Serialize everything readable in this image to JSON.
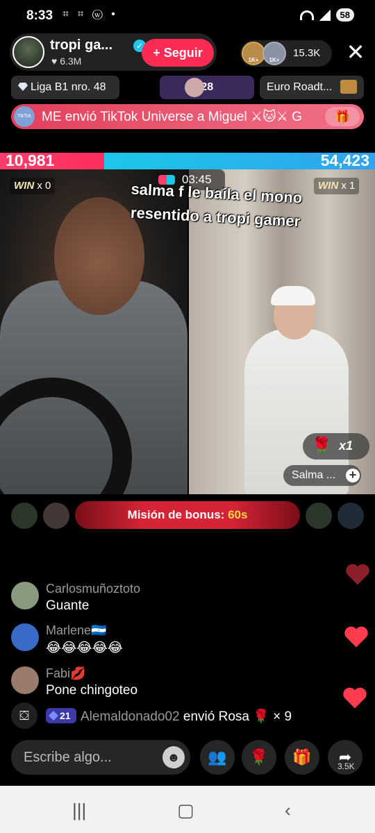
{
  "status_bar": {
    "time": "8:33",
    "notif_icons": "⌗ ⌗ ⓦ •",
    "battery": "58"
  },
  "header": {
    "host_name": "tropi ga...",
    "host_likes": "♥ 6.3M",
    "follow_label": "+ Seguir",
    "viewer_badge_1": "1K+",
    "viewer_badge_2": "1K+",
    "viewer_count": "15.3K",
    "close_symbol": "✕"
  },
  "tags": {
    "league": "Liga B1 nro. 48",
    "plus": "+28",
    "roadtrip": "Euro Roadt..."
  },
  "banner": {
    "logo_text": "TikTok LIVE",
    "text": "ME envió TikTok Universe a Miguel ⚔🐱⚔ G",
    "gift_symbol": "🎁"
  },
  "battle": {
    "score_left": "10,981",
    "score_right": "54,423",
    "win_left_label": "WIN",
    "win_left_count": "x 0",
    "win_right_label": "WIN",
    "win_right_count": "x 1",
    "timer": "03:45",
    "caption": "salma f le baila el mono resentido a tropi gamer",
    "gift_count": "x1",
    "guest_name": "Salma ...",
    "guest_plus": "+"
  },
  "mission": {
    "label": "Misión de bonus:",
    "seconds": "60s"
  },
  "chat": [
    {
      "user": "Carlosmuñoztoto",
      "message": "Guante"
    },
    {
      "user": "Marlene🇳🇮",
      "message": "😂😂😂😂😂"
    },
    {
      "user": "Fabi💋",
      "message": "Pone chingoteo"
    }
  ],
  "gift_event": {
    "badge": "21",
    "user": "Alemaldonado02",
    "text": "envió Rosa 🌹 × 9"
  },
  "bottom_bar": {
    "input_placeholder": "Escribe algo...",
    "emoji_symbol": "☻",
    "share_count": "3.5K"
  },
  "colors": {
    "red_team": "#ff3d6a",
    "blue_team": "#1cc7e8",
    "follow": "#fe2c55",
    "mission_seconds": "#ffd54a"
  },
  "icons": [
    "wifi-icon",
    "signal-icon",
    "verified-icon",
    "close-icon",
    "diamond-icon",
    "gift-icon",
    "heart-icon",
    "emoji-icon",
    "multi-guest-icon",
    "rose-icon",
    "share-icon",
    "recent-apps-icon",
    "home-icon",
    "back-icon"
  ]
}
